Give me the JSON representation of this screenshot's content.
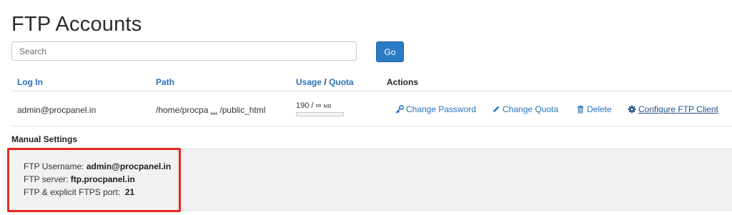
{
  "page_title": "FTP Accounts",
  "search": {
    "placeholder": "Search",
    "value": ""
  },
  "go_button": "Go",
  "table": {
    "headers": {
      "login": "Log In",
      "path": "Path",
      "usage": "Usage",
      "slash": "/",
      "quota": "Quota",
      "actions": "Actions"
    },
    "row": {
      "login": "admin@procpanel.in",
      "path_start": "/home/procpa",
      "path_ellipsis": "...",
      "path_end": "/public_html",
      "usage_value": "190",
      "usage_sep": " / ∞ ",
      "usage_unit": "MB",
      "usage_fraction": 0,
      "actions": {
        "change_password": "Change Password",
        "change_quota": "Change Quota",
        "delete": "Delete",
        "configure": "Configure FTP Client"
      }
    }
  },
  "manual_settings": {
    "heading": "Manual Settings",
    "username_label": "FTP Username: ",
    "username_value": "admin@procpanel.in",
    "server_label": "FTP server: ",
    "server_value": "ftp.procpanel.in",
    "port_label": "FTP & explicit FTPS port:  ",
    "port_value": "21"
  },
  "colors": {
    "link": "#2a72b8",
    "go_button": "#2c7bc6",
    "highlight_box": "#e8261a",
    "panel_background": "#f1f1f1"
  },
  "icons": {
    "change_password": "key-icon",
    "change_quota": "pencil-icon",
    "delete": "trash-icon",
    "configure": "gear-icon"
  }
}
